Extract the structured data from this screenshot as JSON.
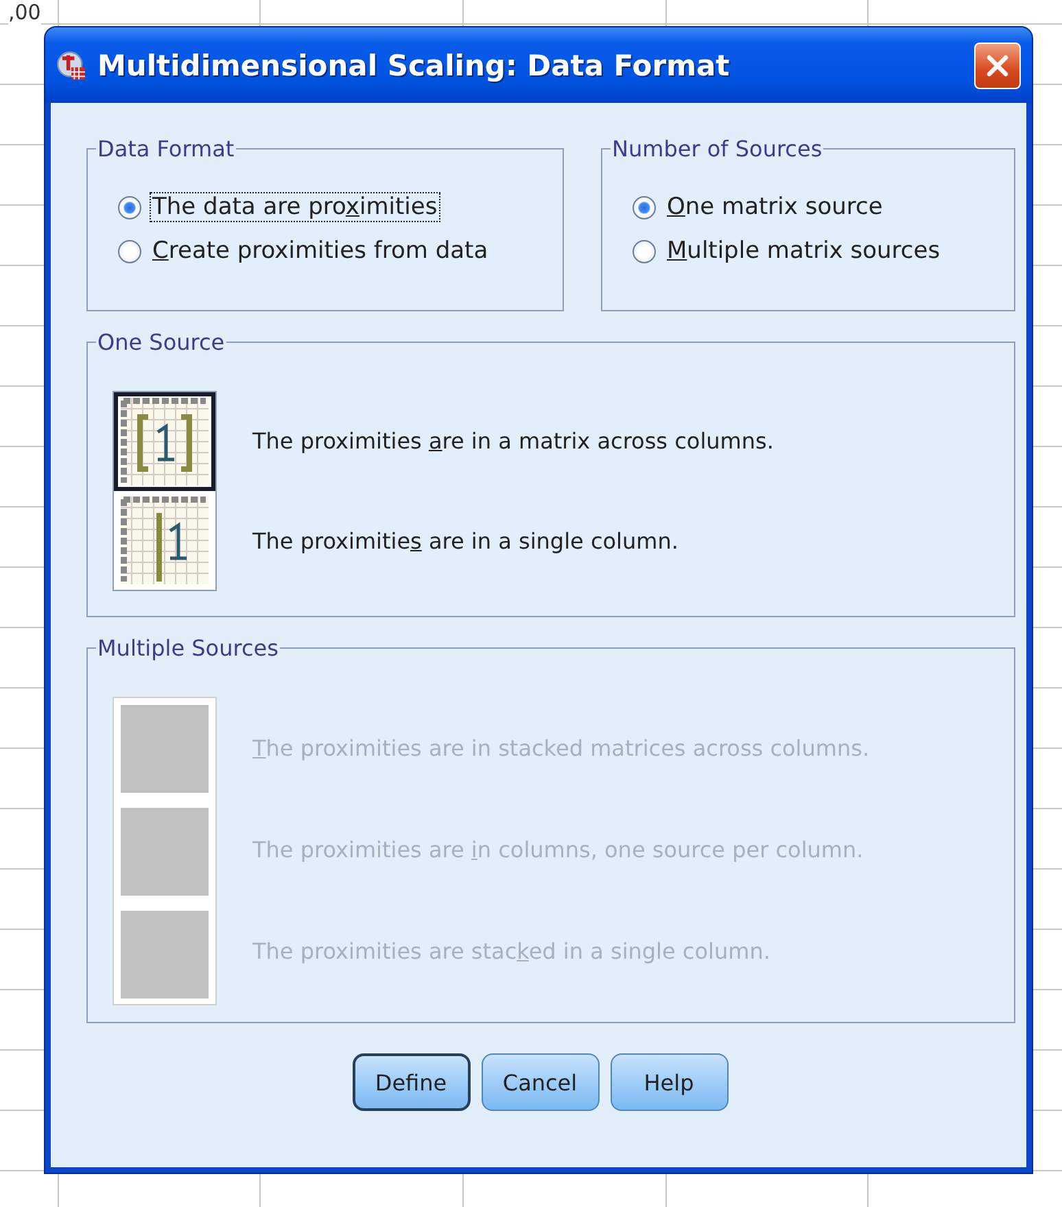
{
  "sheet": {
    "cell_text": ",00"
  },
  "window": {
    "title": "Multidimensional Scaling: Data Format"
  },
  "data_format": {
    "title": "Data Format",
    "options": [
      {
        "before": "The data are pro",
        "key": "x",
        "after": "imities",
        "selected": true,
        "focused": true
      },
      {
        "key": "C",
        "after": "reate proximities from data",
        "selected": false,
        "focused": false
      }
    ]
  },
  "number_of_sources": {
    "title": "Number of Sources",
    "options": [
      {
        "key": "O",
        "after": "ne matrix source",
        "selected": true,
        "focused": false
      },
      {
        "key": "M",
        "after": "ultiple matrix sources",
        "selected": false,
        "focused": false
      }
    ]
  },
  "one_source": {
    "title": "One Source",
    "disabled": false,
    "items": [
      {
        "kind": "matrix",
        "before": "The proximities ",
        "key": "a",
        "after": "re in a matrix across columns.",
        "selected": true
      },
      {
        "kind": "column",
        "before": "The proximitie",
        "key": "s",
        "after": " are in a single column.",
        "selected": false
      }
    ]
  },
  "multiple_sources": {
    "title": "Multiple Sources",
    "disabled": true,
    "items": [
      {
        "key": "T",
        "after": "he proximities are in stacked matrices across columns."
      },
      {
        "before": "The proximities are ",
        "key": "i",
        "after": "n columns, one source per column."
      },
      {
        "before": "The proximities are stac",
        "key": "k",
        "after": "ed in a single column."
      }
    ]
  },
  "buttons": [
    {
      "label": "Define",
      "default": true
    },
    {
      "label": "Cancel",
      "default": false
    },
    {
      "label": "Help",
      "default": false
    }
  ]
}
